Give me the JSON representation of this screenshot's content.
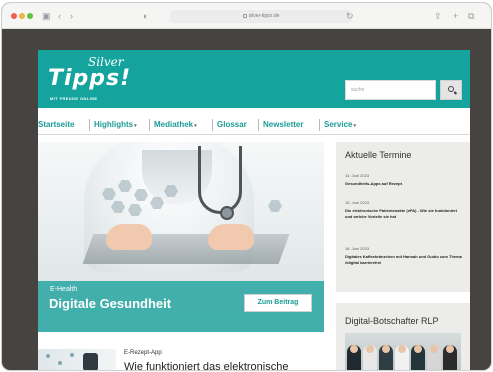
{
  "browser": {
    "url": "silver-tipps.de",
    "icons": {
      "sidebar": "sidebar-icon",
      "back": "back-icon",
      "forward": "forward-icon",
      "privacy": "shield-icon",
      "reload": "reload-icon",
      "share": "share-icon",
      "new_tab": "plus-icon",
      "tabs": "tabs-icon"
    }
  },
  "site": {
    "logo_silver": "Silver",
    "logo_tipps": "Tipps!",
    "logo_tagline": "MIT FREUDE ONLINE",
    "search_placeholder": "suche",
    "brand_color": "#15a39e"
  },
  "nav": {
    "items": [
      {
        "label": "Startseite",
        "caret": ""
      },
      {
        "label": "Highlights",
        "caret": "▾"
      },
      {
        "label": "Mediathek",
        "caret": "▾"
      },
      {
        "label": "Glossar",
        "caret": ""
      },
      {
        "label": "Newsletter",
        "caret": ""
      },
      {
        "label": "Service",
        "caret": "▾"
      }
    ]
  },
  "hero": {
    "kicker": "E-Health",
    "title": "Digitale Gesundheit",
    "button": "Zum Beitrag"
  },
  "events": {
    "title": "Aktuelle Termine",
    "items": [
      {
        "date": "14. Juni 2023",
        "title": "Gesundheits-Apps auf Rezept"
      },
      {
        "date": "15. Juni 2023",
        "title": "Die elektronische Patientenakte (ePA) - Wie sie funktioniert und welche Vorteile sie hat"
      },
      {
        "date": "16. Juni 2023",
        "title": "Digitales Kaffeekränzchen mit Hannah und Guido zum Thema #digital barrierefrei"
      }
    ]
  },
  "rlp": {
    "title": "Digital-Botschafter RLP"
  },
  "teaser": {
    "kicker": "E-Rezept-App",
    "title": "Wie funktioniert das elektronische"
  }
}
